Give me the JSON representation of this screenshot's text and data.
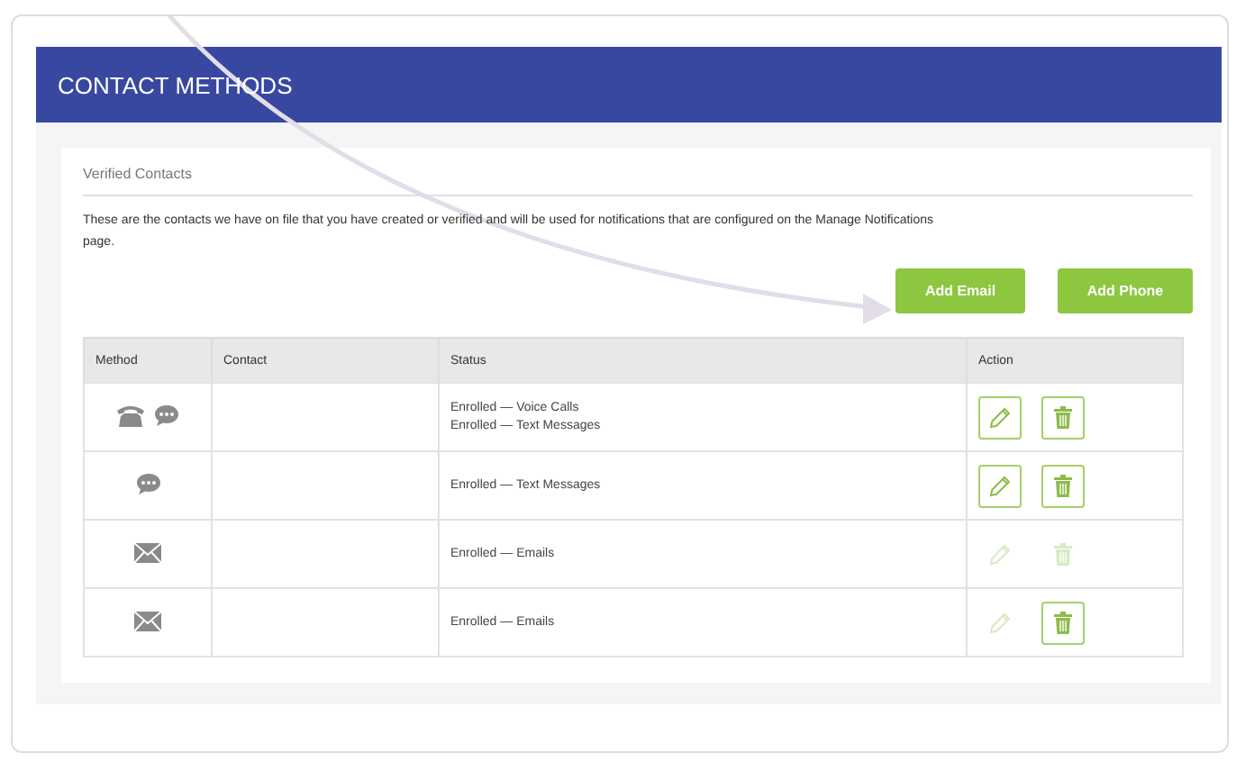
{
  "header": {
    "title": "CONTACT METHODS"
  },
  "panel": {
    "title": "Verified Contacts",
    "description": "These are the contacts we have on file that you have created or verified and will be used for notifications that are configured on the Manage Notifications page."
  },
  "buttons": [
    "Add Email",
    "Add Phone"
  ],
  "table": {
    "columns": [
      "Method",
      "Contact",
      "Status",
      "Action"
    ],
    "rows": [
      {
        "methods": [
          {
            "kind": "phone"
          },
          {
            "kind": "chat"
          }
        ],
        "status": [
          "Enrolled — Voice Calls",
          "Enrolled — Text Messages"
        ],
        "edit_disabled": false,
        "delete_disabled": false
      },
      {
        "methods": [
          {
            "kind": "chat"
          }
        ],
        "status": [
          "Enrolled — Text Messages"
        ],
        "edit_disabled": false,
        "delete_disabled": false
      },
      {
        "methods": [
          {
            "kind": "email"
          }
        ],
        "status": [
          "Enrolled — Emails"
        ],
        "edit_disabled": true,
        "delete_disabled": true
      },
      {
        "methods": [
          {
            "kind": "email"
          }
        ],
        "status": [
          "Enrolled — Emails"
        ],
        "edit_disabled": true,
        "delete_disabled": false
      }
    ]
  }
}
